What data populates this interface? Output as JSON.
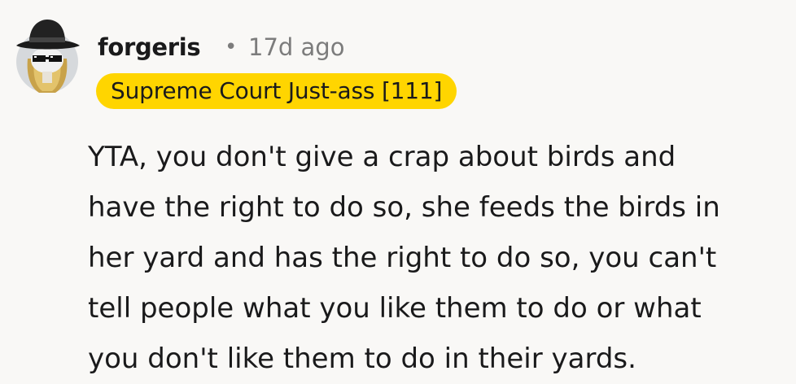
{
  "comment": {
    "username": "forgeris",
    "separator": "•",
    "timestamp": "17d ago",
    "flair": "Supreme Court Just-ass [111]",
    "body_lines": [
      "YTA, you don't give a crap about birds and",
      "have the right to do so, she feeds the birds in",
      "her yard and has the right to do so, you can't",
      "tell people what you like them to do or what",
      "you don't like them to do in their yards."
    ]
  },
  "colors": {
    "background": "#f9f8f6",
    "flair_background": "#ffd500",
    "text": "#1a1a1b",
    "meta": "#7c7c7c"
  },
  "icons": {
    "avatar": "avatar-icon"
  }
}
